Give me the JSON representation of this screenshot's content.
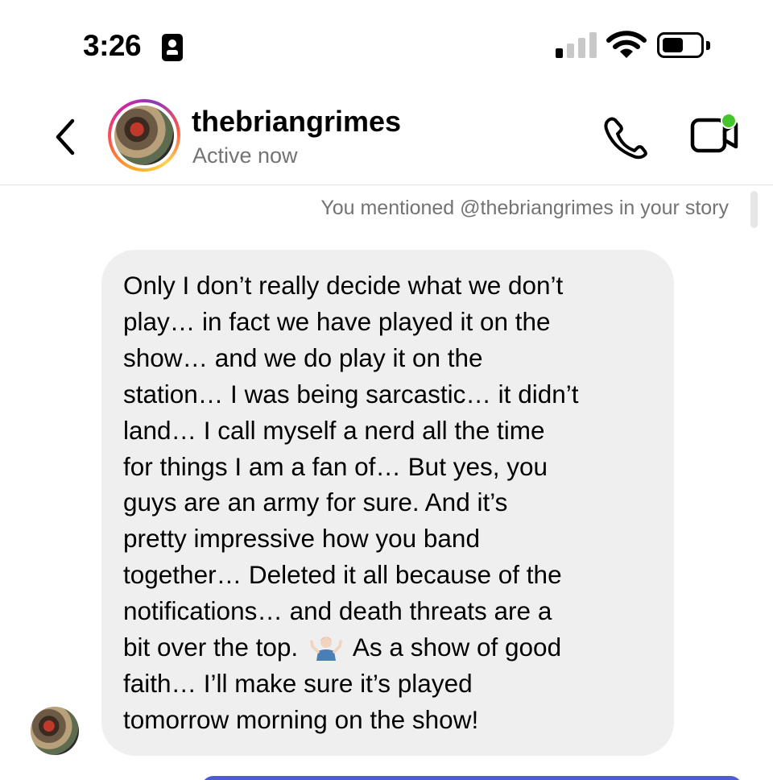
{
  "status_bar": {
    "time": "3:26",
    "signal_bars_active": 1,
    "signal_bars_total": 4,
    "battery_level": 0.55,
    "icons": [
      "contact-card-icon",
      "cellular-signal-icon",
      "wifi-icon",
      "battery-icon"
    ]
  },
  "header": {
    "username": "thebriangrimes",
    "status": "Active now",
    "icons": [
      "back-chevron-icon",
      "phone-icon",
      "video-camera-icon"
    ],
    "online_indicator_color": "#44c52a",
    "story_ring_colors": [
      "#f9a826",
      "#fd5949",
      "#d6249f",
      "#8a3ab9"
    ]
  },
  "conversation": {
    "mention_note": "You mentioned @thebriangrimes in your story",
    "message": {
      "lines": [
        "Only I don’t really decide what we don’t",
        "play… in fact we have played it on the",
        "show… and we do play it on the",
        "station… I was being sarcastic… it didn’t",
        "land… I call myself a nerd all the time",
        "for things I am a fan of… But yes, you",
        "guys are an army for sure. And it’s",
        "pretty impressive how you band",
        "together… Deleted it all because of the",
        "notifications… and death threats are a",
        "bit over the top.",
        "As a show of good",
        "faith… I’ll make sure it’s played",
        "tomorrow morning on the show!"
      ],
      "emoji": "person-shrugging-emoji",
      "bubble_color": "#efefef"
    },
    "outgoing_bubble_color": "#4f5bd5"
  }
}
